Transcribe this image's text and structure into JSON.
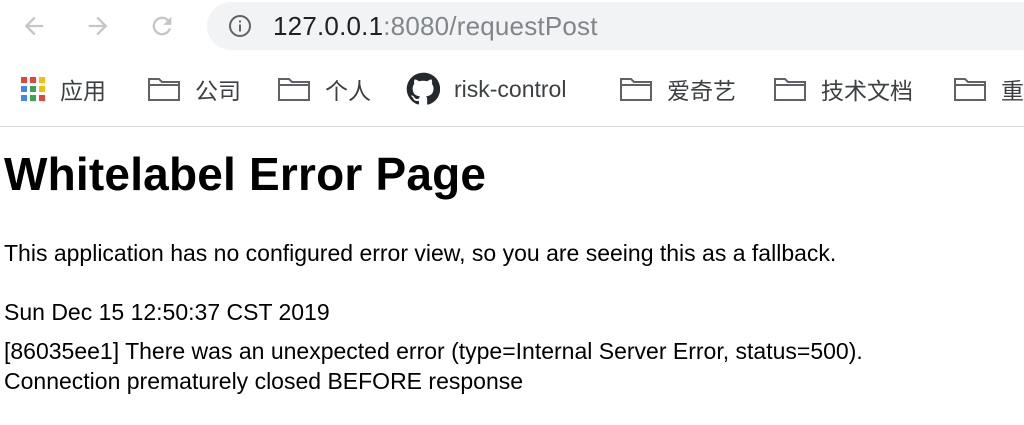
{
  "browser": {
    "url_host": "127.0.0.1",
    "url_rest": ":8080/requestPost"
  },
  "bookmarks": [
    {
      "label": "应用",
      "icon": "apps-grid-icon"
    },
    {
      "label": "公司",
      "icon": "folder-icon"
    },
    {
      "label": "个人",
      "icon": "folder-icon"
    },
    {
      "label": "risk-control",
      "icon": "github-icon"
    },
    {
      "label": "爱奇艺",
      "icon": "folder-icon"
    },
    {
      "label": "技术文档",
      "icon": "folder-icon"
    },
    {
      "label": "重",
      "icon": "folder-icon"
    }
  ],
  "page": {
    "title": "Whitelabel Error Page",
    "intro": "This application has no configured error view, so you are seeing this as a fallback.",
    "timestamp": "Sun Dec 15 12:50:37 CST 2019",
    "error_line": "[86035ee1] There was an unexpected error (type=Internal Server Error, status=500).",
    "detail": "Connection prematurely closed BEFORE response"
  }
}
